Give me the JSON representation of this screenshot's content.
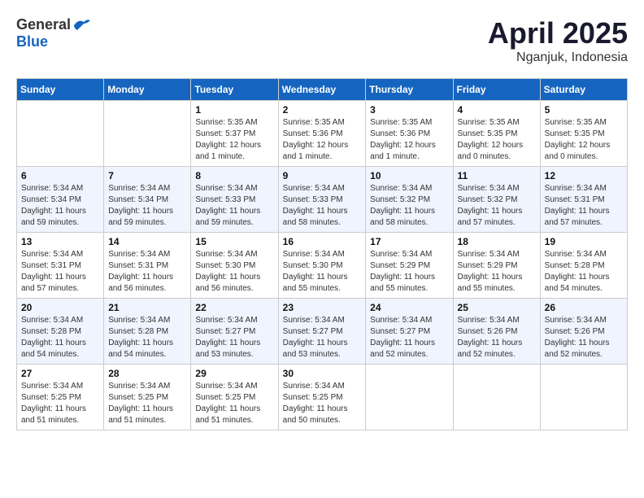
{
  "header": {
    "logo_general": "General",
    "logo_blue": "Blue",
    "month": "April 2025",
    "location": "Nganjuk, Indonesia"
  },
  "weekdays": [
    "Sunday",
    "Monday",
    "Tuesday",
    "Wednesday",
    "Thursday",
    "Friday",
    "Saturday"
  ],
  "weeks": [
    [
      {
        "day": "",
        "detail": ""
      },
      {
        "day": "",
        "detail": ""
      },
      {
        "day": "1",
        "detail": "Sunrise: 5:35 AM\nSunset: 5:37 PM\nDaylight: 12 hours\nand 1 minute."
      },
      {
        "day": "2",
        "detail": "Sunrise: 5:35 AM\nSunset: 5:36 PM\nDaylight: 12 hours\nand 1 minute."
      },
      {
        "day": "3",
        "detail": "Sunrise: 5:35 AM\nSunset: 5:36 PM\nDaylight: 12 hours\nand 1 minute."
      },
      {
        "day": "4",
        "detail": "Sunrise: 5:35 AM\nSunset: 5:35 PM\nDaylight: 12 hours\nand 0 minutes."
      },
      {
        "day": "5",
        "detail": "Sunrise: 5:35 AM\nSunset: 5:35 PM\nDaylight: 12 hours\nand 0 minutes."
      }
    ],
    [
      {
        "day": "6",
        "detail": "Sunrise: 5:34 AM\nSunset: 5:34 PM\nDaylight: 11 hours\nand 59 minutes."
      },
      {
        "day": "7",
        "detail": "Sunrise: 5:34 AM\nSunset: 5:34 PM\nDaylight: 11 hours\nand 59 minutes."
      },
      {
        "day": "8",
        "detail": "Sunrise: 5:34 AM\nSunset: 5:33 PM\nDaylight: 11 hours\nand 59 minutes."
      },
      {
        "day": "9",
        "detail": "Sunrise: 5:34 AM\nSunset: 5:33 PM\nDaylight: 11 hours\nand 58 minutes."
      },
      {
        "day": "10",
        "detail": "Sunrise: 5:34 AM\nSunset: 5:32 PM\nDaylight: 11 hours\nand 58 minutes."
      },
      {
        "day": "11",
        "detail": "Sunrise: 5:34 AM\nSunset: 5:32 PM\nDaylight: 11 hours\nand 57 minutes."
      },
      {
        "day": "12",
        "detail": "Sunrise: 5:34 AM\nSunset: 5:31 PM\nDaylight: 11 hours\nand 57 minutes."
      }
    ],
    [
      {
        "day": "13",
        "detail": "Sunrise: 5:34 AM\nSunset: 5:31 PM\nDaylight: 11 hours\nand 57 minutes."
      },
      {
        "day": "14",
        "detail": "Sunrise: 5:34 AM\nSunset: 5:31 PM\nDaylight: 11 hours\nand 56 minutes."
      },
      {
        "day": "15",
        "detail": "Sunrise: 5:34 AM\nSunset: 5:30 PM\nDaylight: 11 hours\nand 56 minutes."
      },
      {
        "day": "16",
        "detail": "Sunrise: 5:34 AM\nSunset: 5:30 PM\nDaylight: 11 hours\nand 55 minutes."
      },
      {
        "day": "17",
        "detail": "Sunrise: 5:34 AM\nSunset: 5:29 PM\nDaylight: 11 hours\nand 55 minutes."
      },
      {
        "day": "18",
        "detail": "Sunrise: 5:34 AM\nSunset: 5:29 PM\nDaylight: 11 hours\nand 55 minutes."
      },
      {
        "day": "19",
        "detail": "Sunrise: 5:34 AM\nSunset: 5:28 PM\nDaylight: 11 hours\nand 54 minutes."
      }
    ],
    [
      {
        "day": "20",
        "detail": "Sunrise: 5:34 AM\nSunset: 5:28 PM\nDaylight: 11 hours\nand 54 minutes."
      },
      {
        "day": "21",
        "detail": "Sunrise: 5:34 AM\nSunset: 5:28 PM\nDaylight: 11 hours\nand 54 minutes."
      },
      {
        "day": "22",
        "detail": "Sunrise: 5:34 AM\nSunset: 5:27 PM\nDaylight: 11 hours\nand 53 minutes."
      },
      {
        "day": "23",
        "detail": "Sunrise: 5:34 AM\nSunset: 5:27 PM\nDaylight: 11 hours\nand 53 minutes."
      },
      {
        "day": "24",
        "detail": "Sunrise: 5:34 AM\nSunset: 5:27 PM\nDaylight: 11 hours\nand 52 minutes."
      },
      {
        "day": "25",
        "detail": "Sunrise: 5:34 AM\nSunset: 5:26 PM\nDaylight: 11 hours\nand 52 minutes."
      },
      {
        "day": "26",
        "detail": "Sunrise: 5:34 AM\nSunset: 5:26 PM\nDaylight: 11 hours\nand 52 minutes."
      }
    ],
    [
      {
        "day": "27",
        "detail": "Sunrise: 5:34 AM\nSunset: 5:25 PM\nDaylight: 11 hours\nand 51 minutes."
      },
      {
        "day": "28",
        "detail": "Sunrise: 5:34 AM\nSunset: 5:25 PM\nDaylight: 11 hours\nand 51 minutes."
      },
      {
        "day": "29",
        "detail": "Sunrise: 5:34 AM\nSunset: 5:25 PM\nDaylight: 11 hours\nand 51 minutes."
      },
      {
        "day": "30",
        "detail": "Sunrise: 5:34 AM\nSunset: 5:25 PM\nDaylight: 11 hours\nand 50 minutes."
      },
      {
        "day": "",
        "detail": ""
      },
      {
        "day": "",
        "detail": ""
      },
      {
        "day": "",
        "detail": ""
      }
    ]
  ]
}
